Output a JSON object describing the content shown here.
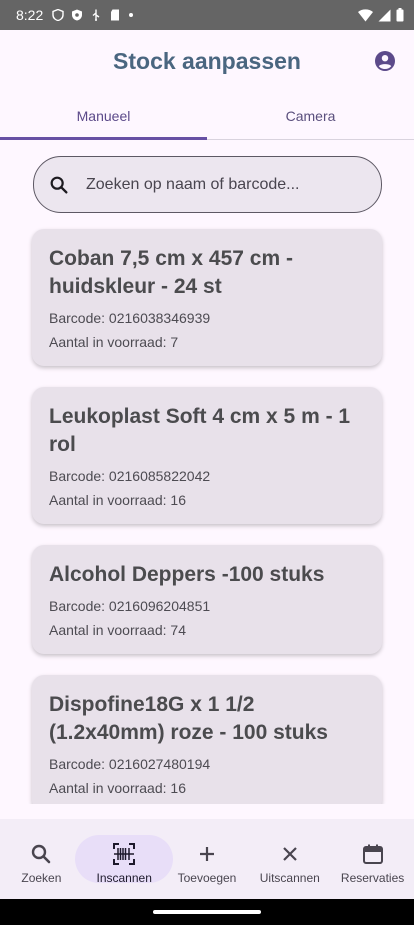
{
  "status": {
    "time": "8:22"
  },
  "app": {
    "title": "Stock aanpassen"
  },
  "tabs": [
    {
      "label": "Manueel",
      "active": true
    },
    {
      "label": "Camera",
      "active": false
    }
  ],
  "search": {
    "placeholder": "Zoeken op naam of barcode..."
  },
  "products": [
    {
      "name": "Coban 7,5 cm x 457 cm - huidskleur - 24 st",
      "barcode": "Barcode: 0216038346939",
      "stock": "Aantal in voorraad: 7"
    },
    {
      "name": "Leukoplast Soft 4 cm x 5 m - 1 rol",
      "barcode": "Barcode: 0216085822042",
      "stock": "Aantal in voorraad: 16"
    },
    {
      "name": "Alcohol Deppers -100 stuks",
      "barcode": "Barcode: 0216096204851",
      "stock": "Aantal in voorraad: 74"
    },
    {
      "name": "Dispofine18G x 1 1/2 (1.2x40mm) roze - 100 stuks",
      "barcode": "Barcode: 0216027480194",
      "stock": "Aantal in voorraad: 16"
    }
  ],
  "nav": [
    {
      "label": "Zoeken",
      "icon": "search-icon",
      "active": false
    },
    {
      "label": "Inscannen",
      "icon": "barcode-scan-icon",
      "active": true
    },
    {
      "label": "Toevoegen",
      "icon": "plus-icon",
      "active": false
    },
    {
      "label": "Uitscannen",
      "icon": "close-icon",
      "active": false
    },
    {
      "label": "Reservaties",
      "icon": "calendar-icon",
      "active": false
    }
  ],
  "colors": {
    "accent": "#6750a4",
    "title": "#4a6680",
    "card": "#e8e1ea",
    "background": "#fef7ff"
  }
}
